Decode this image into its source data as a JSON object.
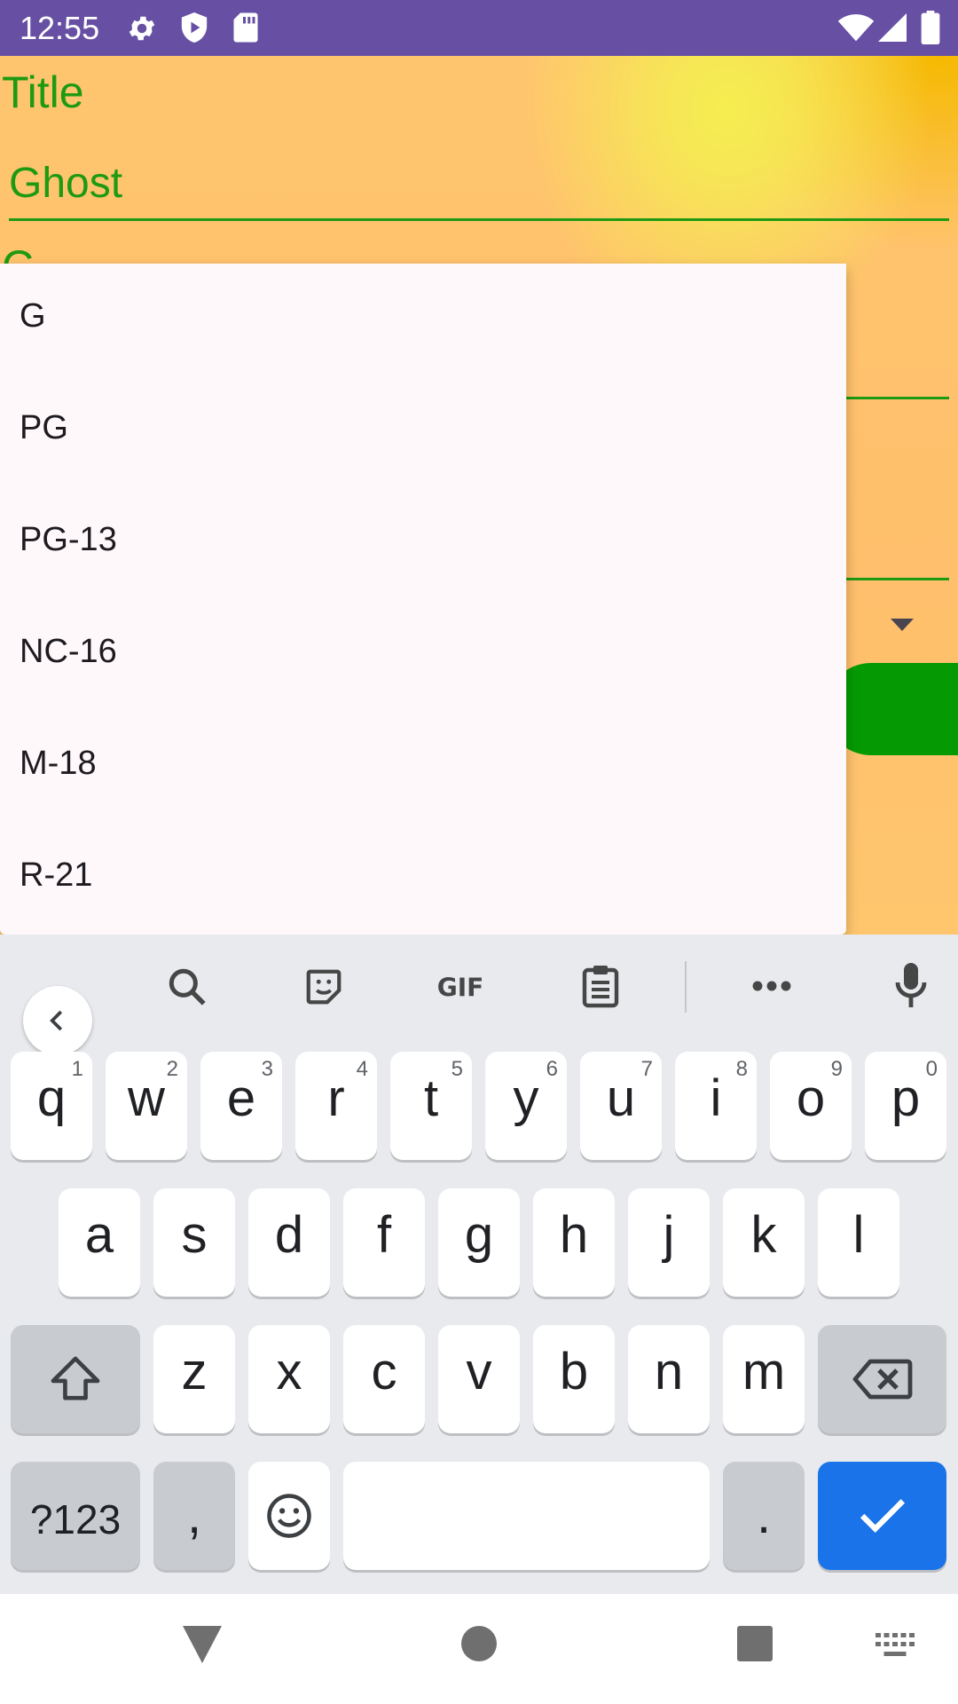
{
  "status_bar": {
    "time": "12:55",
    "icons": [
      "settings-icon",
      "shield-icon",
      "sd-card-icon",
      "wifi-icon",
      "signal-icon",
      "battery-icon"
    ]
  },
  "form": {
    "title_label": "Title",
    "title_value": "Ghost",
    "next_label_peek": "C"
  },
  "dropdown": {
    "options": [
      "G",
      "PG",
      "PG-13",
      "NC-16",
      "M-18",
      "R-21"
    ]
  },
  "keyboard": {
    "toolbar": [
      "back-icon",
      "search-icon",
      "sticker-icon",
      "gif-icon",
      "clipboard-icon",
      "more-icon",
      "mic-icon"
    ],
    "row1": [
      {
        "key": "q",
        "hint": "1"
      },
      {
        "key": "w",
        "hint": "2"
      },
      {
        "key": "e",
        "hint": "3"
      },
      {
        "key": "r",
        "hint": "4"
      },
      {
        "key": "t",
        "hint": "5"
      },
      {
        "key": "y",
        "hint": "6"
      },
      {
        "key": "u",
        "hint": "7"
      },
      {
        "key": "i",
        "hint": "8"
      },
      {
        "key": "o",
        "hint": "9"
      },
      {
        "key": "p",
        "hint": "0"
      }
    ],
    "row2": [
      "a",
      "s",
      "d",
      "f",
      "g",
      "h",
      "j",
      "k",
      "l"
    ],
    "row3": [
      "z",
      "x",
      "c",
      "v",
      "b",
      "n",
      "m"
    ],
    "symbols_label": "?123",
    "comma": ",",
    "period": "."
  },
  "colors": {
    "status_bar": "#6750a4",
    "accent_green": "#1e9a12",
    "button_green": "#059a04",
    "enter_key": "#1a73e8"
  }
}
